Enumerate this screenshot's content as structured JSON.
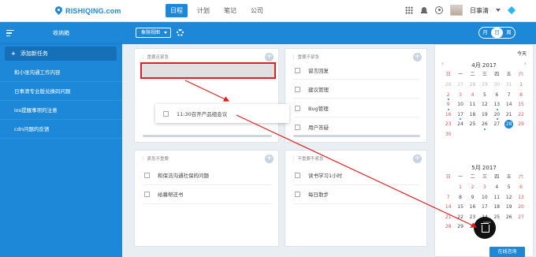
{
  "app": {
    "logo_text": "RISHIQING.com"
  },
  "nav": {
    "items": [
      {
        "label": "日程",
        "active": true
      },
      {
        "label": "计划",
        "active": false
      },
      {
        "label": "笔记",
        "active": false
      },
      {
        "label": "公司",
        "active": false
      }
    ]
  },
  "user": {
    "name": "日事清"
  },
  "sidebar": {
    "title": "收纳箱",
    "add_label": "添加新任务",
    "add_icon": "+",
    "items": [
      {
        "label": "和小张沟通工作内容"
      },
      {
        "label": "日事清专业版兑换码问题"
      },
      {
        "label": "ios提醒事项的注意"
      },
      {
        "label": "cdn问题的反馈"
      }
    ]
  },
  "toolbar": {
    "view_select": "象限视图",
    "segments": [
      {
        "label": "月",
        "active": false
      },
      {
        "label": "日",
        "active": true
      },
      {
        "label": "周",
        "active": false
      }
    ]
  },
  "quadrants": {
    "q1": {
      "title": "重要且紧急",
      "tasks": []
    },
    "q2": {
      "title": "重要不紧急",
      "tasks": [
        {
          "label": "留言回复"
        },
        {
          "label": "建议管理"
        },
        {
          "label": "Bug管理"
        },
        {
          "label": "用户答疑"
        }
      ]
    },
    "q3": {
      "title": "紧急不重要",
      "tasks": [
        {
          "label": "和保洁沟通社保的问题"
        },
        {
          "label": "给幕帮还书"
        }
      ]
    },
    "q4": {
      "title": "不重要不紧急",
      "tasks": [
        {
          "label": "读书学习1小时"
        },
        {
          "label": "每日散步"
        }
      ]
    }
  },
  "dragging_task": {
    "label": "11:30召开产品组会议"
  },
  "calendar": {
    "today_label": "今天",
    "prev_icon": "‹",
    "next_icon": "›",
    "weekdays": [
      "日",
      "一",
      "二",
      "三",
      "四",
      "五",
      "六"
    ],
    "months": [
      {
        "title": "4月 2017",
        "days": [
          {
            "d": "26",
            "gray": true
          },
          {
            "d": "27",
            "gray": true
          },
          {
            "d": "28",
            "gray": true
          },
          {
            "d": "29",
            "gray": true
          },
          {
            "d": "30",
            "gray": true
          },
          {
            "d": "31",
            "gray": true
          },
          {
            "d": "1",
            "red": true
          },
          {
            "d": "2",
            "red": true,
            "dot": true
          },
          {
            "d": "3",
            "red": true
          },
          {
            "d": "4",
            "red": true
          },
          {
            "d": "5"
          },
          {
            "d": "6"
          },
          {
            "d": "7"
          },
          {
            "d": "8",
            "red": true
          },
          {
            "d": "9",
            "red": true,
            "dot": true
          },
          {
            "d": "10"
          },
          {
            "d": "11"
          },
          {
            "d": "12"
          },
          {
            "d": "13",
            "dot": true
          },
          {
            "d": "14"
          },
          {
            "d": "15",
            "red": true
          },
          {
            "d": "16",
            "red": true
          },
          {
            "d": "17",
            "dot": true
          },
          {
            "d": "18"
          },
          {
            "d": "19"
          },
          {
            "d": "20",
            "dot": true
          },
          {
            "d": "21"
          },
          {
            "d": "22",
            "red": true
          },
          {
            "d": "23",
            "red": true
          },
          {
            "d": "24"
          },
          {
            "d": "25"
          },
          {
            "d": "26",
            "dot": true
          },
          {
            "d": "27"
          },
          {
            "d": "28",
            "today": true
          },
          {
            "d": "29",
            "red": true
          },
          {
            "d": "30",
            "red": true
          }
        ]
      },
      {
        "title": "5月 2017",
        "days": [
          {
            "d": ""
          },
          {
            "d": "1",
            "red": true
          },
          {
            "d": "2",
            "red": true
          },
          {
            "d": "3",
            "red": true
          },
          {
            "d": "4"
          },
          {
            "d": "5"
          },
          {
            "d": "6",
            "red": true
          },
          {
            "d": "7",
            "red": true
          },
          {
            "d": "8"
          },
          {
            "d": "9"
          },
          {
            "d": "10"
          },
          {
            "d": "11"
          },
          {
            "d": "12"
          },
          {
            "d": "13",
            "red": true
          },
          {
            "d": "14",
            "red": true
          },
          {
            "d": "15"
          },
          {
            "d": "16"
          },
          {
            "d": "17"
          },
          {
            "d": "18"
          },
          {
            "d": "19"
          },
          {
            "d": "20",
            "red": true
          },
          {
            "d": "21",
            "red": true
          },
          {
            "d": "22"
          },
          {
            "d": "23"
          },
          {
            "d": "24"
          },
          {
            "d": "25"
          },
          {
            "d": "26"
          },
          {
            "d": "27",
            "red": true
          },
          {
            "d": "28",
            "red": true
          },
          {
            "d": "29"
          },
          {
            "d": "30"
          },
          {
            "d": "31"
          }
        ]
      }
    ]
  },
  "online_button": "在线咨询",
  "colors": {
    "accent": "#1e88d8",
    "highlight": "#e02020",
    "holiday": "#e05555"
  }
}
